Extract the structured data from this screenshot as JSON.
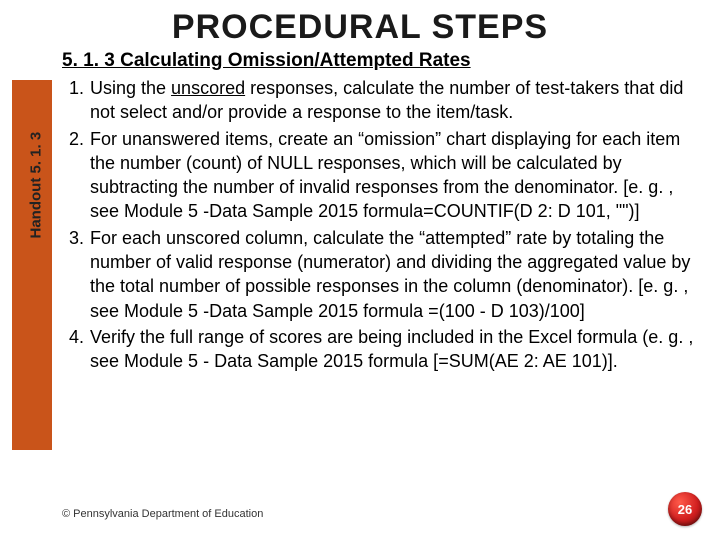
{
  "title": "PROCEDURAL STEPS",
  "sideLabel": "Handout 5. 1. 3",
  "section": {
    "heading": "5. 1. 3 Calculating Omission/Attempted Rates",
    "steps": [
      {
        "num": "1.",
        "prefix": "Using the ",
        "under": "unscored",
        "rest": " responses, calculate the number of test-takers that did not select and/or provide a response to the item/task."
      },
      {
        "num": "2.",
        "prefix": "",
        "under": "",
        "rest": "For unanswered items, create an “omission” chart displaying for each item the number (count) of NULL responses, which will be calculated by subtracting the number of invalid responses from the denominator. [e. g. , see Module 5 -Data Sample 2015 formula=COUNTIF(D 2: D 101, \"\")]"
      },
      {
        "num": "3.",
        "prefix": "",
        "under": "",
        "rest": "For each unscored column, calculate the “attempted” rate by totaling the number of valid response (numerator) and dividing the aggregated value by the total number of possible responses in the column (denominator). [e. g. , see Module 5 -Data Sample 2015 formula =(100 - D 103)/100]"
      },
      {
        "num": "4.",
        "prefix": "",
        "under": "",
        "rest": "Verify the full range of scores are being included in the Excel formula (e. g. , see Module 5 - Data Sample 2015 formula [=SUM(AE 2: AE 101)]."
      }
    ]
  },
  "footer": "© Pennsylvania Department of Education",
  "pageNumber": "26"
}
